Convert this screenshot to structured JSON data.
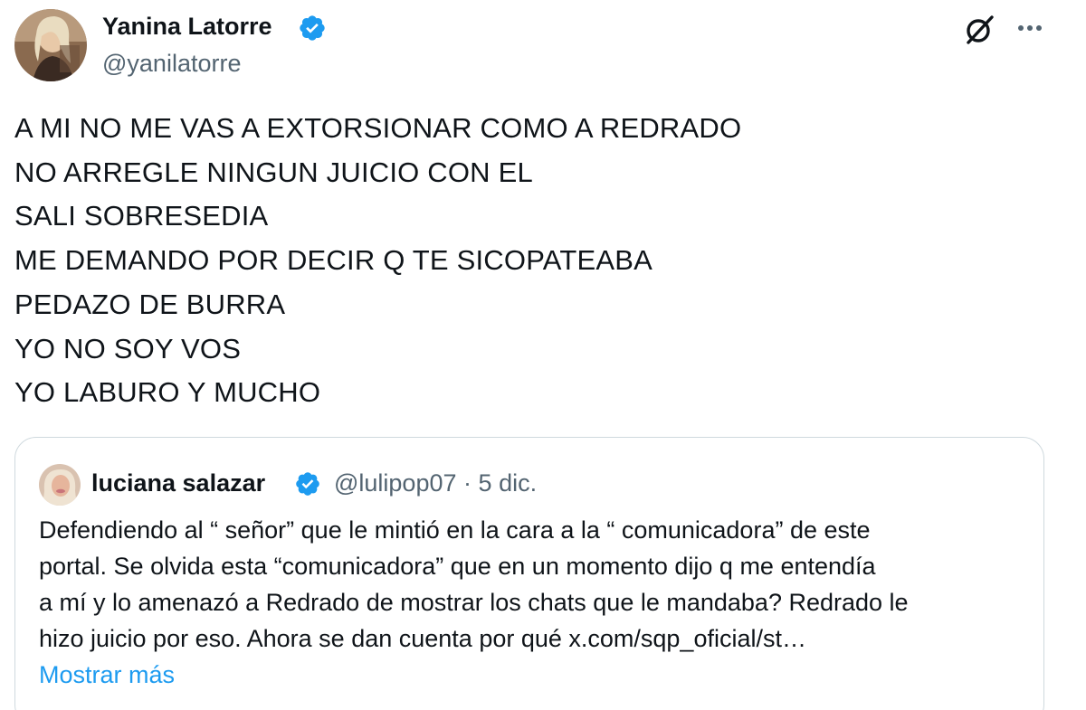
{
  "post": {
    "author": {
      "name": "Yanina Latorre",
      "handle": "@yanilatorre",
      "verified": true
    },
    "header_icons": [
      "grok-icon",
      "more-options-icon"
    ],
    "text_lines": [
      "A MI NO ME VAS A EXTORSIONAR COMO A REDRADO",
      "NO ARREGLE NINGUN JUICIO CON EL",
      "SALI SOBRESEDIA",
      "ME DEMANDO POR DECIR Q TE SICOPATEABA",
      "PEDAZO DE BURRA",
      "YO NO SOY VOS",
      "YO LABURO Y MUCHO"
    ]
  },
  "quote": {
    "author": {
      "name": "luciana salazar",
      "handle": "@lulipop07",
      "verified": true
    },
    "separator": "·",
    "date": "5 dic.",
    "text_lines": [
      "Defendiendo al “ señor”  que le mintió en la cara a la “ comunicadora” de este",
      "portal. Se olvida esta “comunicadora” que en un momento dijo q me entendía",
      "a mí y lo amenazó a Redrado de mostrar los chats que le mandaba? Redrado le",
      "hizo juicio por eso.  Ahora se dan cuenta por qué x.com/sqp_oficial/st…"
    ],
    "show_more": "Mostrar más"
  },
  "colors": {
    "text": "#0f1419",
    "secondary": "#536471",
    "accent": "#1d9bf0",
    "border": "#cfd9de"
  }
}
